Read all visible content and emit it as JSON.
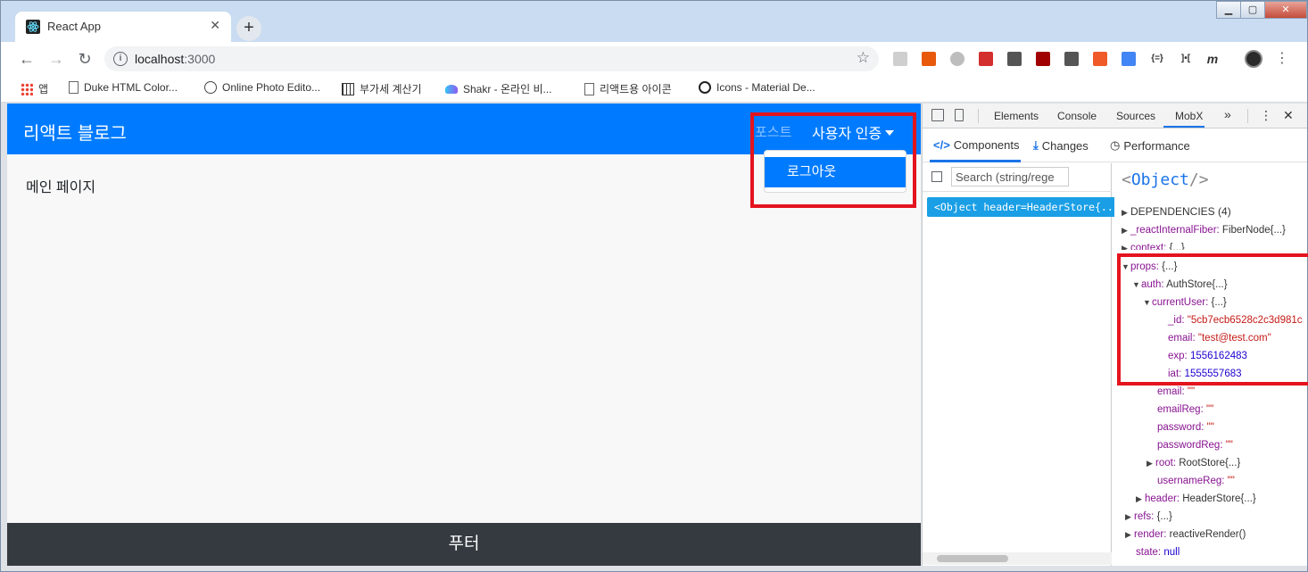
{
  "browser": {
    "tab_title": "React App",
    "url_host": "localhost",
    "url_port": ":3000",
    "bookmarks": [
      {
        "label": "앱"
      },
      {
        "label": "Duke HTML Color..."
      },
      {
        "label": "Online Photo Edito..."
      },
      {
        "label": "부가세 계산기"
      },
      {
        "label": "Shakr - 온라인 비..."
      },
      {
        "label": "리액트용 아이콘"
      },
      {
        "label": "Icons - Material De..."
      }
    ],
    "ext_labels": [
      "{=}",
      "]•[",
      "m"
    ]
  },
  "app": {
    "brand": "리액트 블로그",
    "nav_post": "포스트",
    "nav_auth": "사용자 인증",
    "dropdown_item": "로그아웃",
    "main_text": "메인 페이지",
    "footer": "푸터"
  },
  "devtools": {
    "tabs": [
      "Elements",
      "Console",
      "Sources",
      "MobX"
    ],
    "more_tabs": "»",
    "mobx_tabs": [
      "Components",
      "Changes",
      "Performance"
    ],
    "search_placeholder": "Search (string/rege",
    "tree_node": "<Object header=HeaderStore{...",
    "object_title_open": "<",
    "object_title_tag": "Object",
    "object_title_close": "/>",
    "dependencies": "DEPENDENCIES (4)",
    "props": {
      "reactInternalFiber": {
        "key": "_reactInternalFiber:",
        "value": "FiberNode{...}"
      },
      "context": {
        "key": "context:",
        "value": "{...}"
      },
      "props": {
        "key": "props:",
        "value": "{...}"
      },
      "auth": {
        "key": "auth:",
        "value": "AuthStore{...}"
      },
      "currentUser": {
        "key": "currentUser:",
        "value": "{...}"
      },
      "id": {
        "key": "_id:",
        "value": "\"5cb7ecb6528c2c3d981c"
      },
      "cu_email": {
        "key": "email:",
        "value": "\"test@test.com\""
      },
      "exp": {
        "key": "exp:",
        "value": "1556162483"
      },
      "iat": {
        "key": "iat:",
        "value": "1555557683"
      },
      "email": {
        "key": "email:",
        "value": "\"\""
      },
      "emailReg": {
        "key": "emailReg:",
        "value": "\"\""
      },
      "password": {
        "key": "password:",
        "value": "\"\""
      },
      "passwordReg": {
        "key": "passwordReg:",
        "value": "\"\""
      },
      "root": {
        "key": "root:",
        "value": "RootStore{...}"
      },
      "usernameReg": {
        "key": "usernameReg:",
        "value": "\"\""
      },
      "header": {
        "key": "header:",
        "value": "HeaderStore{...}"
      },
      "refs": {
        "key": "refs:",
        "value": "{...}"
      },
      "render": {
        "key": "render:",
        "value": "reactiveRender()"
      },
      "state": {
        "key": "state:",
        "value": "null"
      }
    }
  },
  "colors": {
    "navbar": "#007bff",
    "footer": "#343a40",
    "highlight": "#e4141f"
  }
}
